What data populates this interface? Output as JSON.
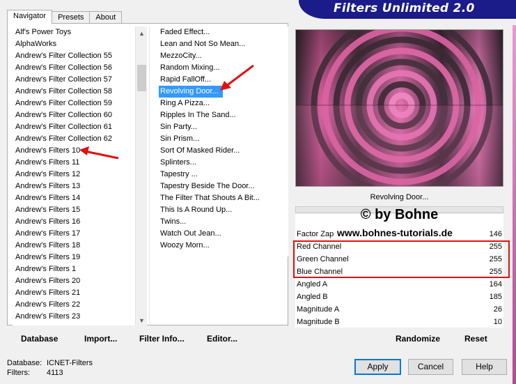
{
  "banner": {
    "title": "Filters Unlimited 2.0"
  },
  "tabs": [
    {
      "label": "Navigator",
      "active": true
    },
    {
      "label": "Presets",
      "active": false
    },
    {
      "label": "About",
      "active": false
    }
  ],
  "categories": [
    "Alf's Power Toys",
    "AlphaWorks",
    "Andrew's Filter Collection 55",
    "Andrew's Filter Collection 56",
    "Andrew's Filter Collection 57",
    "Andrew's Filter Collection 58",
    "Andrew's Filter Collection 59",
    "Andrew's Filter Collection 60",
    "Andrew's Filter Collection 61",
    "Andrew's Filter Collection 62",
    "Andrew's Filters 10",
    "Andrew's Filters 11",
    "Andrew's Filters 12",
    "Andrew's Filters 13",
    "Andrew's Filters 14",
    "Andrew's Filters 15",
    "Andrew's Filters 16",
    "Andrew's Filters 17",
    "Andrew's Filters 18",
    "Andrew's Filters 19",
    "Andrew's Filters 1",
    "Andrew's Filters 20",
    "Andrew's Filters 21",
    "Andrew's Filters 22",
    "Andrew's Filters 23"
  ],
  "filters": [
    "Faded Effect...",
    "Lean and Not So Mean...",
    "MezzoCity...",
    "Random Mixing...",
    "Rapid FallOff...",
    "Revolving Door...",
    "Ring A Pizza...",
    "Ripples In The Sand...",
    "Sin Party...",
    "Sin Prism...",
    "Sort Of Masked Rider...",
    "Splinters...",
    "Tapestry ...",
    "Tapestry Beside The Door...",
    "The Filter That Shouts A Bit...",
    "This Is A Round Up...",
    "Twins...",
    "Watch Out Jean...",
    "Woozy Morn..."
  ],
  "selected_filter_index": 5,
  "preview": {
    "filter_name": "Revolving Door..."
  },
  "watermark": {
    "copyright": "© by Bohne",
    "website": "www.bohnes-tutorials.de"
  },
  "params": [
    {
      "name": "Factor Zap",
      "value": "146"
    },
    {
      "name": "Red Channel",
      "value": "255"
    },
    {
      "name": "Green Channel",
      "value": "255"
    },
    {
      "name": "Blue Channel",
      "value": "255"
    },
    {
      "name": "Angled A",
      "value": "164"
    },
    {
      "name": "Angled B",
      "value": "185"
    },
    {
      "name": "Magnitude A",
      "value": "26"
    },
    {
      "name": "Magnitude B",
      "value": "10"
    }
  ],
  "toolbar": {
    "database": "Database",
    "import": "Import...",
    "filter_info": "Filter Info...",
    "editor": "Editor...",
    "randomize": "Randomize",
    "reset": "Reset"
  },
  "status": {
    "database_label": "Database:",
    "database_value": "ICNET-Filters",
    "filters_label": "Filters:",
    "filters_value": "4113"
  },
  "buttons": {
    "apply": "Apply",
    "cancel": "Cancel",
    "help": "Help"
  },
  "colors": {
    "banner": "#1b1b8a",
    "selection": "#3399ff",
    "annotation_red": "#e01010",
    "preview_pink": "#e86aad"
  }
}
